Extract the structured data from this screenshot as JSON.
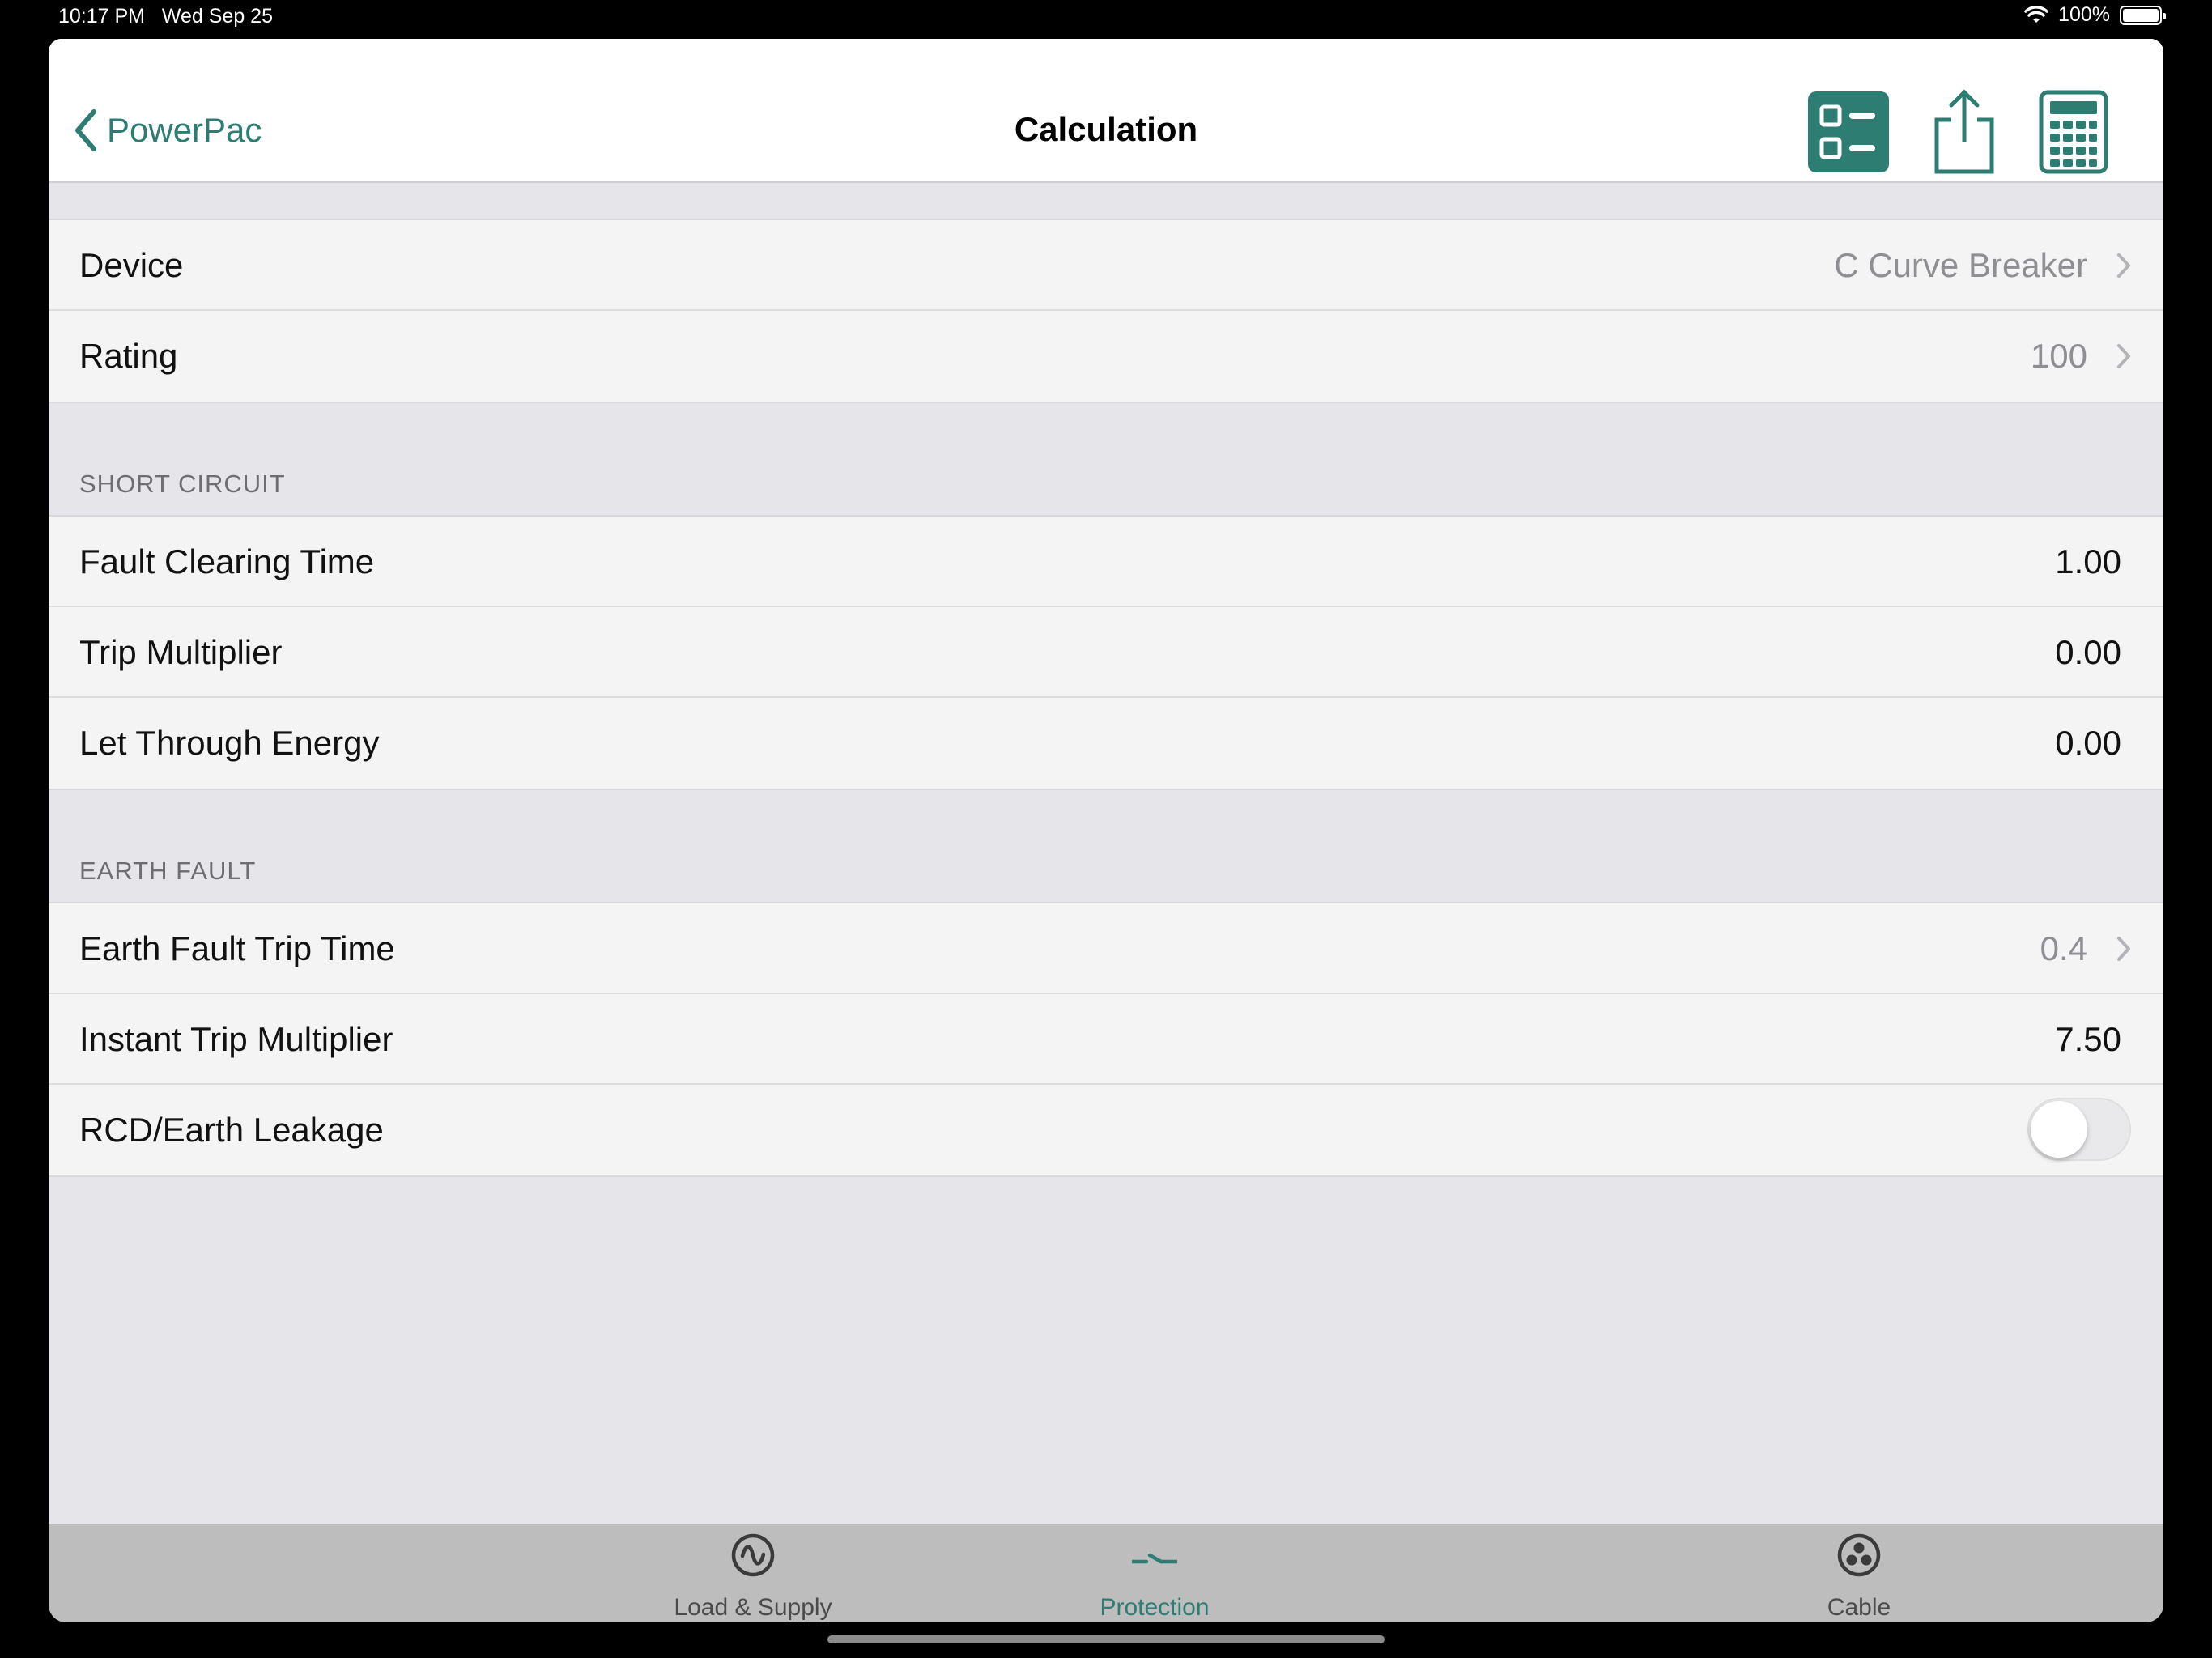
{
  "status_bar": {
    "time": "10:17 PM",
    "date": "Wed Sep 25",
    "battery": "100%"
  },
  "nav": {
    "back_label": "PowerPac",
    "title": "Calculation",
    "actions": [
      "list-icon",
      "share-icon",
      "calculator-icon"
    ]
  },
  "device_group": {
    "device": {
      "label": "Device",
      "value": "C Curve Breaker"
    },
    "rating": {
      "label": "Rating",
      "value": "100"
    }
  },
  "short_circuit": {
    "header": "SHORT CIRCUIT",
    "fault_clearing_time": {
      "label": "Fault Clearing Time",
      "value": "1.00"
    },
    "trip_multiplier": {
      "label": "Trip Multiplier",
      "value": "0.00"
    },
    "let_through_energy": {
      "label": "Let Through Energy",
      "value": "0.00"
    }
  },
  "earth_fault": {
    "header": "EARTH FAULT",
    "earth_fault_trip_time": {
      "label": "Earth Fault Trip Time",
      "value": "0.4"
    },
    "instant_trip_multiplier": {
      "label": "Instant Trip Multiplier",
      "value": "7.50"
    },
    "rcd_earth_leakage": {
      "label": "RCD/Earth Leakage",
      "enabled": false
    }
  },
  "tab_bar": {
    "tabs": [
      {
        "label": "Load & Supply",
        "icon": "sine-wave-icon",
        "active": false
      },
      {
        "label": "Protection",
        "icon": "switch-icon",
        "active": true
      },
      {
        "label": "Cable",
        "icon": "cable-icon",
        "active": false
      }
    ]
  },
  "colors": {
    "accent": "#2d7d72",
    "grouped_background": "#e6e6ea",
    "tab_bar_background": "#bdbdbd"
  }
}
